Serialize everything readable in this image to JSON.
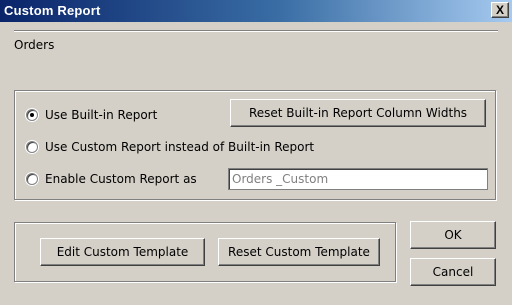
{
  "window": {
    "title": "Custom Report",
    "close_glyph": "X"
  },
  "report_name": "Orders",
  "options": {
    "use_builtin_label": "Use Built-in Report",
    "use_custom_label": "Use Custom Report instead of Built-in Report",
    "enable_custom_label": "Enable Custom Report as",
    "selected": "use_builtin"
  },
  "buttons": {
    "reset_widths": "Reset Built-in Report Column Widths",
    "edit_template": "Edit Custom Template",
    "reset_template": "Reset Custom Template",
    "ok": "OK",
    "cancel": "Cancel"
  },
  "custom_name_field": {
    "value": "Orders _Custom"
  }
}
